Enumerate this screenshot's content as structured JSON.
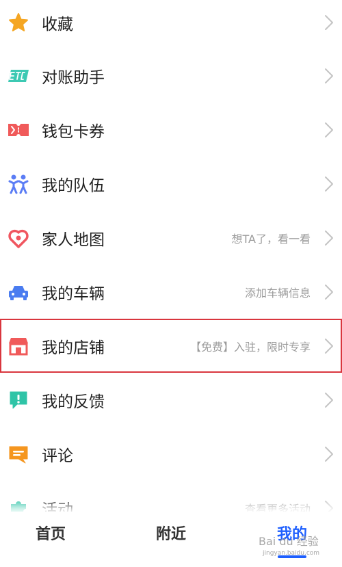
{
  "menu": {
    "items": [
      {
        "label": "收藏",
        "hint": "",
        "icon": "star-icon"
      },
      {
        "label": "对账助手",
        "hint": "",
        "icon": "etc-icon"
      },
      {
        "label": "钱包卡券",
        "hint": "",
        "icon": "ticket-icon"
      },
      {
        "label": "我的队伍",
        "hint": "",
        "icon": "team-icon"
      },
      {
        "label": "家人地图",
        "hint": "想TA了，看一看",
        "icon": "heart-location-icon"
      },
      {
        "label": "我的车辆",
        "hint": "添加车辆信息",
        "icon": "car-icon"
      },
      {
        "label": "我的店铺",
        "hint": "【免费】入驻，限时专享",
        "icon": "store-icon"
      },
      {
        "label": "我的反馈",
        "hint": "",
        "icon": "feedback-icon"
      },
      {
        "label": "评论",
        "hint": "",
        "icon": "comment-icon"
      },
      {
        "label": "活动",
        "hint": "查看更多活动",
        "icon": "puzzle-icon"
      }
    ]
  },
  "bottom_nav": {
    "tabs": [
      {
        "label": "首页"
      },
      {
        "label": "附近"
      },
      {
        "label": "我的"
      }
    ],
    "active_index": 2
  },
  "watermark": {
    "text": "Bai du 经验",
    "subtext": "jingyan.baidu.com"
  },
  "colors": {
    "accent": "#1e5ffe",
    "highlight_border": "#d9363e",
    "star": "#f5a623",
    "etc": "#3dc9b3",
    "ticket": "#f05a5a",
    "team": "#5b7df5",
    "heart": "#f0565f",
    "car": "#4a7cf0",
    "store": "#f05a5a",
    "feedback": "#2fc4a7",
    "comment": "#f5961f",
    "puzzle": "#2fc4a7"
  }
}
